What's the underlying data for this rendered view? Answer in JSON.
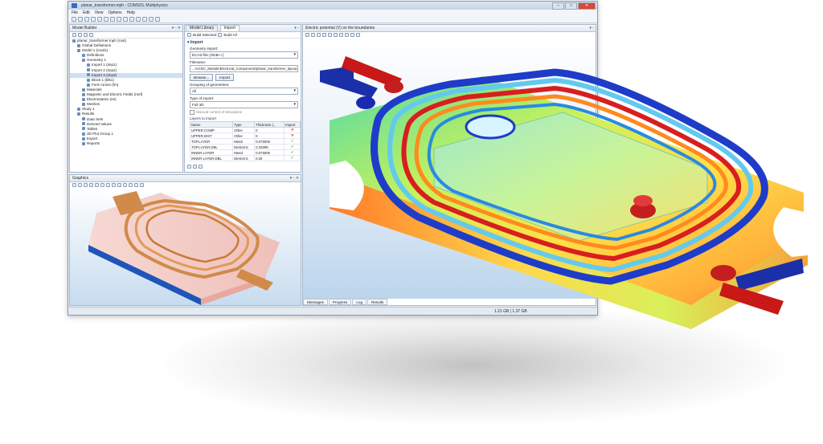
{
  "window": {
    "title": "planar_transformer.mph - COMSOL Multiphysics",
    "menu": [
      "File",
      "Edit",
      "View",
      "Options",
      "Help"
    ]
  },
  "model_builder": {
    "title": "Model Builder",
    "tree": [
      {
        "label": "planar_transformer.mph (root)",
        "indent": 0
      },
      {
        "label": "Global Definitions",
        "indent": 1
      },
      {
        "label": "Model 1 (mod1)",
        "indent": 1
      },
      {
        "label": "Definitions",
        "indent": 2
      },
      {
        "label": "Geometry 1",
        "indent": 2
      },
      {
        "label": "Import 1 (imp1)",
        "indent": 3
      },
      {
        "label": "Import 2 (imp2)",
        "indent": 3
      },
      {
        "label": "Import 3 (imp3)",
        "indent": 3,
        "selected": true
      },
      {
        "label": "Block 1 (blk1)",
        "indent": 3
      },
      {
        "label": "Form Union (fin)",
        "indent": 3
      },
      {
        "label": "Materials",
        "indent": 2
      },
      {
        "label": "Magnetic and Electric Fields (mef)",
        "indent": 2
      },
      {
        "label": "Electrostatics (es)",
        "indent": 2
      },
      {
        "label": "Meshes",
        "indent": 2
      },
      {
        "label": "Study 1",
        "indent": 1
      },
      {
        "label": "Results",
        "indent": 1
      },
      {
        "label": "Data Sets",
        "indent": 2
      },
      {
        "label": "Derived Values",
        "indent": 2
      },
      {
        "label": "Tables",
        "indent": 2
      },
      {
        "label": "3D Plot Group 1",
        "indent": 2
      },
      {
        "label": "Export",
        "indent": 2
      },
      {
        "label": "Reports",
        "indent": 2
      }
    ]
  },
  "import_panel": {
    "tabs": [
      "Model Library",
      "Import"
    ],
    "build_selected": "Build Selected",
    "build_all": "Build All",
    "section": "Import",
    "geometry_import_label": "Geometry import:",
    "geometry_import_value": "ECAD file (ODB++)",
    "filename_label": "Filename:",
    "filename_value": "...\\ACDC_Module\\Electrical_Components\\planar_transformer_layout.xml",
    "browse": "Browse...",
    "import": "Import",
    "grouping_label": "Grouping of geometries:",
    "grouping_value": "All",
    "type_label": "Type of import:",
    "type_value": "Full 3D",
    "manual_control": "Manual control of elevations",
    "layers_title": "Layers to import",
    "columns": [
      "Name",
      "Type",
      "Thickness (...",
      "Import"
    ],
    "rows": [
      {
        "name": "UPPER.COMP",
        "type": "Other",
        "thickness": "0",
        "import": "no"
      },
      {
        "name": "UPPER.DIST",
        "type": "Other",
        "thickness": "0",
        "import": "no"
      },
      {
        "name": "TOP.LAYER",
        "type": "Metal",
        "thickness": "0.075000",
        "import": "yes"
      },
      {
        "name": "TOP.LAYER.DBL",
        "type": "Dielectric",
        "thickness": "0.32899",
        "import": "yes"
      },
      {
        "name": "INNER.LAYER",
        "type": "Metal",
        "thickness": "0.075000",
        "import": "yes"
      },
      {
        "name": "INNER.LAYER.DBL",
        "type": "Dielectric",
        "thickness": "0.25",
        "import": "yes"
      }
    ]
  },
  "graphics_panel": {
    "title": "Graphics"
  },
  "plot_panel": {
    "title": "Electric potential (V) on the boundaries"
  },
  "bottom_tabs": [
    "Messages",
    "Progress",
    "Log",
    "Results"
  ],
  "status": {
    "memory": "1.21 GB | 1.37 GB"
  },
  "colors": {
    "accent": "#1d3c6b",
    "copper": "#d08a4a",
    "pink": "#f3c9c4"
  }
}
